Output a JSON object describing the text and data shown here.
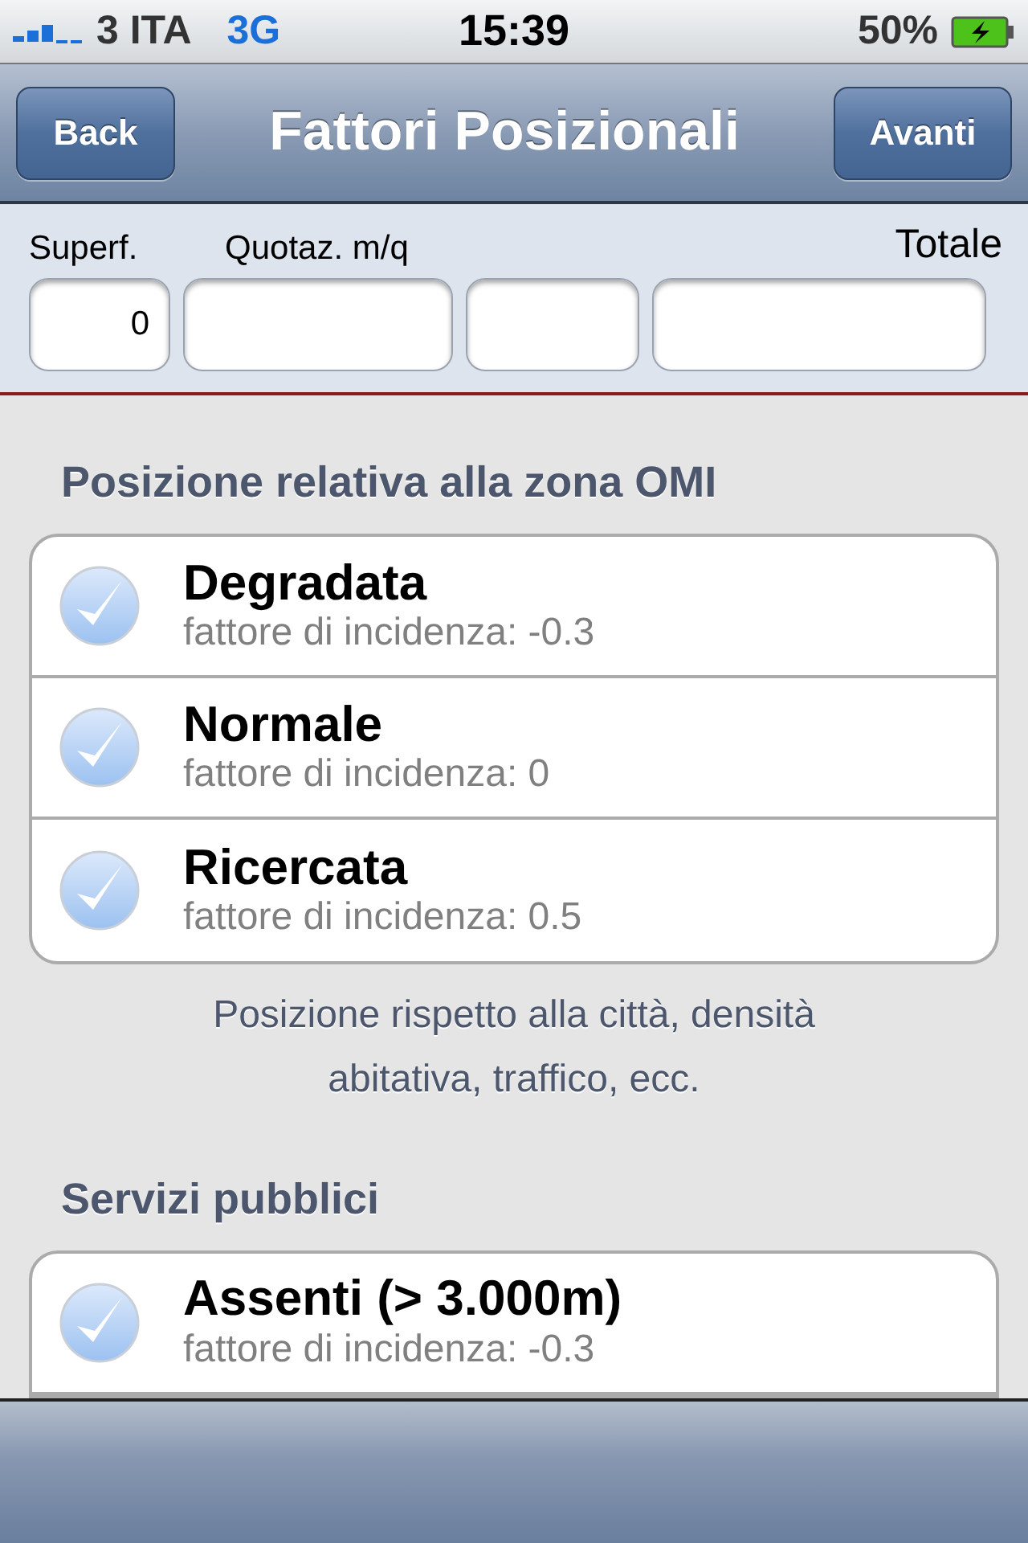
{
  "status_bar": {
    "carrier": "3 ITA",
    "network": "3G",
    "time": "15:39",
    "battery": "50%"
  },
  "nav": {
    "back": "Back",
    "title": "Fattori Posizionali",
    "next": "Avanti"
  },
  "header": {
    "labels": {
      "area": "Superf.",
      "price": "Quotaz. m/q",
      "total": "Totale"
    },
    "area_value": "0"
  },
  "sections": [
    {
      "title": "Posizione relativa alla zona OMI",
      "items": [
        {
          "label": "Degradata",
          "detail": "fattore di incidenza: -0.3",
          "checked": false
        },
        {
          "label": "Normale",
          "detail": "fattore di incidenza: 0",
          "checked": false
        },
        {
          "label": "Ricercata",
          "detail": "fattore di incidenza: 0.5",
          "checked": false
        }
      ],
      "footer": "Posizione rispetto alla città, densità abitativa, traffico, ecc."
    },
    {
      "title": "Servizi pubblici",
      "items": [
        {
          "label": "Assenti (> 3.000m)",
          "detail": "fattore di incidenza: -0.3",
          "checked": false
        }
      ]
    }
  ]
}
